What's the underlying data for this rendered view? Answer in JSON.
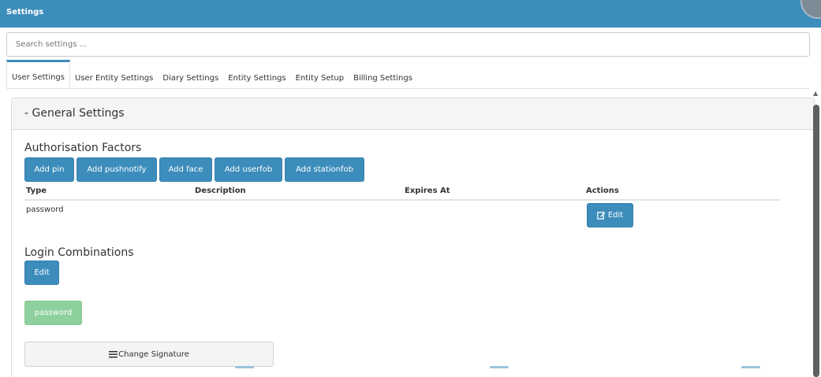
{
  "title": "Settings",
  "search": {
    "placeholder": "Search settings ..."
  },
  "tabs": [
    {
      "label": "User Settings",
      "active": true
    },
    {
      "label": "User Entity Settings"
    },
    {
      "label": "Diary Settings"
    },
    {
      "label": "Entity Settings"
    },
    {
      "label": "Entity Setup"
    },
    {
      "label": "Billing Settings"
    }
  ],
  "panel": {
    "header": "- General Settings",
    "auth": {
      "title": "Authorisation Factors",
      "buttons": [
        "Add pin",
        "Add pushnotify",
        "Add face",
        "Add userfob",
        "Add stationfob"
      ],
      "columns": [
        "Type",
        "Description",
        "Expires At",
        "Actions"
      ],
      "rows": [
        {
          "type": "password",
          "description": "",
          "expires_at": "",
          "action": "Edit"
        }
      ]
    },
    "login": {
      "title": "Login Combinations",
      "edit_label": "Edit",
      "combination": "password"
    },
    "signature": {
      "label": "Change Signature"
    }
  },
  "colors": {
    "accent": "#3c8dbc",
    "success": "#8fd19e",
    "header_bg": "#f5f5f5"
  },
  "icons": {
    "edit": "edit-icon",
    "signature": "menu-icon"
  }
}
